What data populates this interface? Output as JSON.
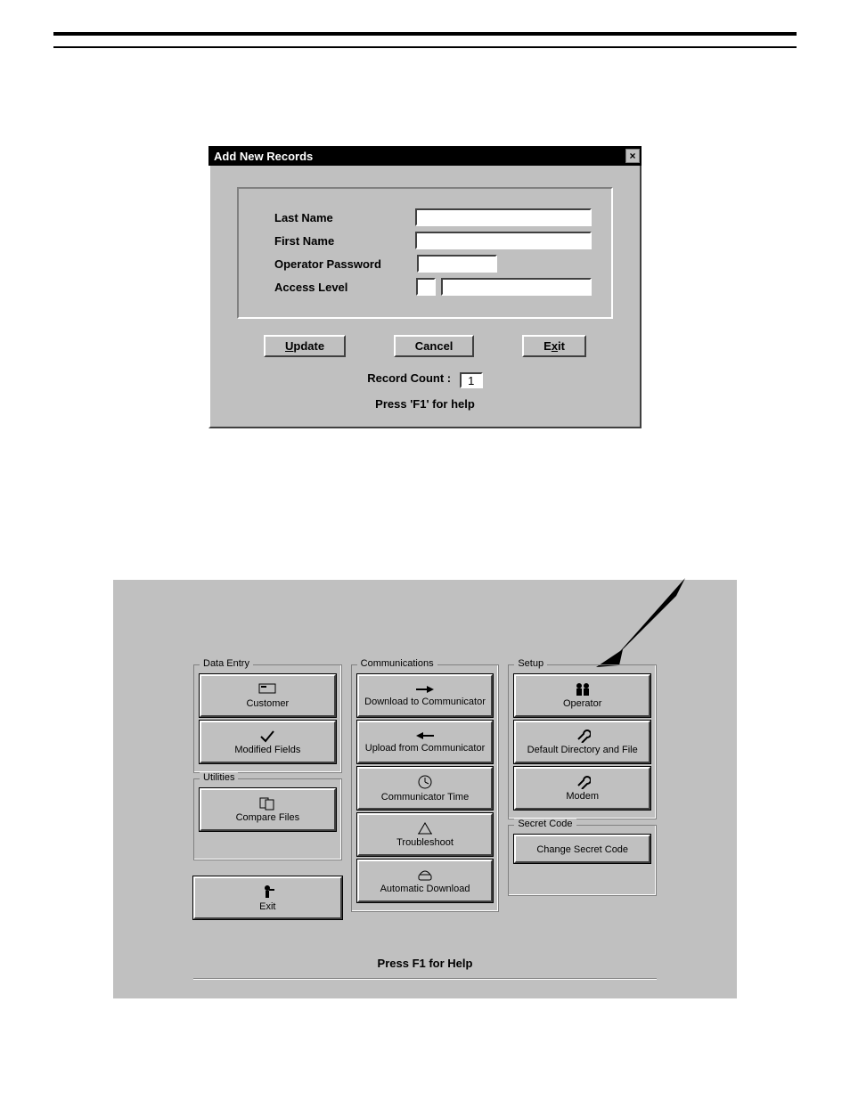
{
  "dialog": {
    "title": "Add New Records",
    "labels": {
      "last_name": "Last Name",
      "first_name": "First Name",
      "operator_password": "Operator Password",
      "access_level": "Access Level"
    },
    "buttons": {
      "update_pre": "U",
      "update_post": "pdate",
      "cancel": "Cancel",
      "exit_pre": "E",
      "exit_mid": "x",
      "exit_post": "it"
    },
    "record_count_label": "Record Count :",
    "record_count_value": "1",
    "help_hint": "Press 'F1' for help"
  },
  "main": {
    "groups": {
      "data_entry": "Data Entry",
      "utilities": "Utilities",
      "communications": "Communications",
      "setup": "Setup",
      "secret_code": "Secret Code"
    },
    "buttons": {
      "customer": "Customer",
      "modified_fields": "Modified Fields",
      "compare_files": "Compare Files",
      "exit": "Exit",
      "download": "Download to Communicator",
      "upload": "Upload from Communicator",
      "comm_time": "Communicator Time",
      "troubleshoot": "Troubleshoot",
      "auto_download": "Automatic Download",
      "operator": "Operator",
      "default_dir": "Default Directory and File",
      "modem": "Modem",
      "change_secret": "Change Secret Code"
    },
    "help_hint": "Press F1 for Help"
  }
}
